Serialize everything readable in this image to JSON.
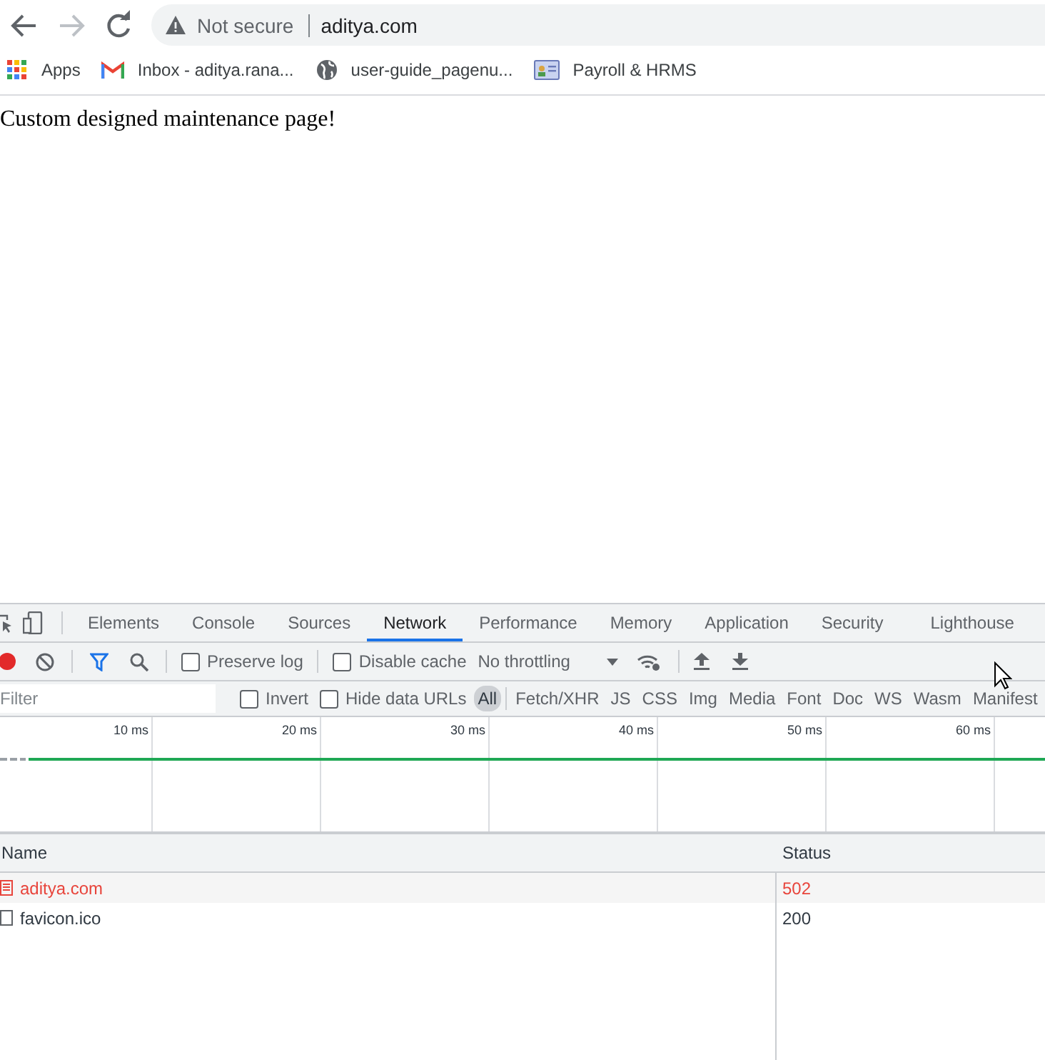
{
  "address_bar": {
    "security_label": "Not secure",
    "url": "aditya.com"
  },
  "bookmarks": [
    {
      "kind": "apps",
      "label": "Apps"
    },
    {
      "kind": "mail",
      "label": "Inbox - aditya.rana..."
    },
    {
      "kind": "globe",
      "label": "user-guide_pagenu..."
    },
    {
      "kind": "card",
      "label": "Payroll & HRMS"
    }
  ],
  "page": {
    "text": "Custom designed maintenance page!"
  },
  "devtools": {
    "tabs": [
      {
        "label": "Elements",
        "selected": false
      },
      {
        "label": "Console",
        "selected": false
      },
      {
        "label": "Sources",
        "selected": false
      },
      {
        "label": "Network",
        "selected": true
      },
      {
        "label": "Performance",
        "selected": false
      },
      {
        "label": "Memory",
        "selected": false
      },
      {
        "label": "Application",
        "selected": false
      },
      {
        "label": "Security",
        "selected": false
      },
      {
        "label": "Lighthouse",
        "selected": false
      }
    ],
    "toolbar": {
      "preserve_log": {
        "label": "Preserve log",
        "checked": false
      },
      "disable_cache": {
        "label": "Disable cache",
        "checked": false
      },
      "throttling": "No throttling"
    },
    "filter": {
      "placeholder": "Filter",
      "invert": {
        "label": "Invert",
        "checked": false
      },
      "hide_data_urls": {
        "label": "Hide data URLs",
        "checked": false
      },
      "types": [
        {
          "label": "All",
          "selected": true
        },
        {
          "label": "Fetch/XHR",
          "selected": false
        },
        {
          "label": "JS",
          "selected": false
        },
        {
          "label": "CSS",
          "selected": false
        },
        {
          "label": "Img",
          "selected": false
        },
        {
          "label": "Media",
          "selected": false
        },
        {
          "label": "Font",
          "selected": false
        },
        {
          "label": "Doc",
          "selected": false
        },
        {
          "label": "WS",
          "selected": false
        },
        {
          "label": "Wasm",
          "selected": false
        },
        {
          "label": "Manifest",
          "selected": false
        }
      ]
    },
    "timeline": {
      "ticks": [
        "10 ms",
        "20 ms",
        "30 ms",
        "40 ms",
        "50 ms",
        "60 ms"
      ]
    },
    "table": {
      "columns": [
        "Name",
        "Status"
      ],
      "rows": [
        {
          "kind": "document",
          "name": "aditya.com",
          "status": "502",
          "error": true
        },
        {
          "kind": "file",
          "name": "favicon.ico",
          "status": "200",
          "error": false
        }
      ]
    }
  }
}
